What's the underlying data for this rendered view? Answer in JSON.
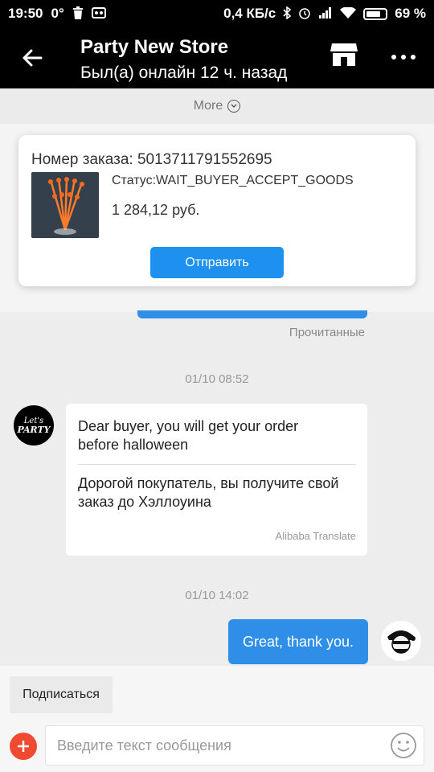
{
  "status_bar": {
    "time": "19:50",
    "temperature": "0°",
    "network_speed": "0,4 КБ/с",
    "battery_percent": "69 %",
    "icons": [
      "trash-icon",
      "voicemail-icon",
      "bluetooth-icon",
      "alarm-icon",
      "signal-icon",
      "wifi-icon",
      "battery-icon"
    ]
  },
  "header": {
    "title": "Party New Store",
    "subtitle": "Был(а) онлайн 12 ч. назад",
    "icons": [
      "back-arrow-icon",
      "store-icon",
      "more-dots-icon"
    ]
  },
  "more_bar": {
    "label": "More",
    "icon": "chevron-down-circle-icon"
  },
  "order_card": {
    "order_number": "Номер заказа: 5013711791552695",
    "status": "Статус:WAIT_BUYER_ACCEPT_GOODS",
    "price": "1 284,12 руб.",
    "send_button": "Отправить"
  },
  "chat": {
    "read_label": "Прочитанные",
    "timestamp_1": "01/10 08:52",
    "store_avatar": {
      "line1": "Let's",
      "line2": "PARTY"
    },
    "incoming_message": {
      "original": "Dear buyer, you will get your order before halloween",
      "translated": "Дорогой покупатель, вы получите свой заказ до Хэллоуина",
      "credit": "Alibaba Translate"
    },
    "timestamp_2": "01/10 14:02",
    "outgoing_message": "Great, thank you."
  },
  "bottom": {
    "subscribe_button": "Подписаться",
    "input_placeholder": "Введите текст сообщения",
    "icons": [
      "plus-icon",
      "smiley-icon"
    ]
  },
  "colors": {
    "bar_background": "#000000",
    "accent_blue": "#1e90f0",
    "plus_red": "#f04a32"
  }
}
